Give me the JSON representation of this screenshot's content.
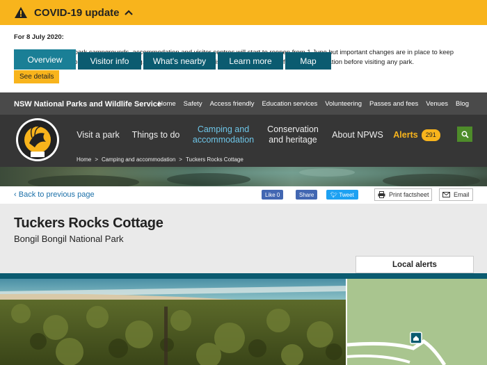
{
  "covid": {
    "title": "COVID-19 update",
    "date": "For 8 July 2020:",
    "body": "Many NSW national park campgrounds, accommodation and visitor centres will start to reopen from 1 June but important changes are in place to keep visitors safe. All camping requires a booking. Check park alerts and visit COVID-19 updates for more information before visiting any park.",
    "button": "See details"
  },
  "topnav": {
    "org": "NSW National Parks and Wildlife Service",
    "links": [
      "Home",
      "Safety",
      "Access friendly",
      "Education services",
      "Volunteering",
      "Passes and fees",
      "Venues",
      "Blog"
    ]
  },
  "mainnav": {
    "items": [
      {
        "label": "Visit a park"
      },
      {
        "label": "Things to do"
      },
      {
        "label": "Camping and accommodation"
      },
      {
        "label": "Conservation and heritage"
      },
      {
        "label": "About NPWS"
      }
    ],
    "alerts_label": "Alerts",
    "alerts_count": "291",
    "logo_text_top": "NATIONAL PARKS & WILDLIFE SERVICE",
    "logo_text_bottom": "NSW"
  },
  "breadcrumb": {
    "items": [
      "Home",
      "Camping and accommodation",
      "Tuckers Rocks Cottage"
    ],
    "sep": ">"
  },
  "toolbar": {
    "back": "Back to previous page",
    "fb_like": "Like 0",
    "fb_share": "Share",
    "tweet": "Tweet",
    "print": "Print factsheet",
    "email": "Email"
  },
  "page": {
    "title": "Tuckers Rocks Cottage",
    "subtitle": "Bongil Bongil National Park"
  },
  "tabs": [
    "Overview",
    "Visitor info",
    "What's nearby",
    "Learn more",
    "Map"
  ],
  "local_alerts": "Local alerts",
  "colors": {
    "banner": "#f8b41c",
    "nav_dark": "#363636",
    "tab": "#0b5b70",
    "accent_link": "#1a6fa8",
    "active_menu": "#6ec6e8"
  }
}
